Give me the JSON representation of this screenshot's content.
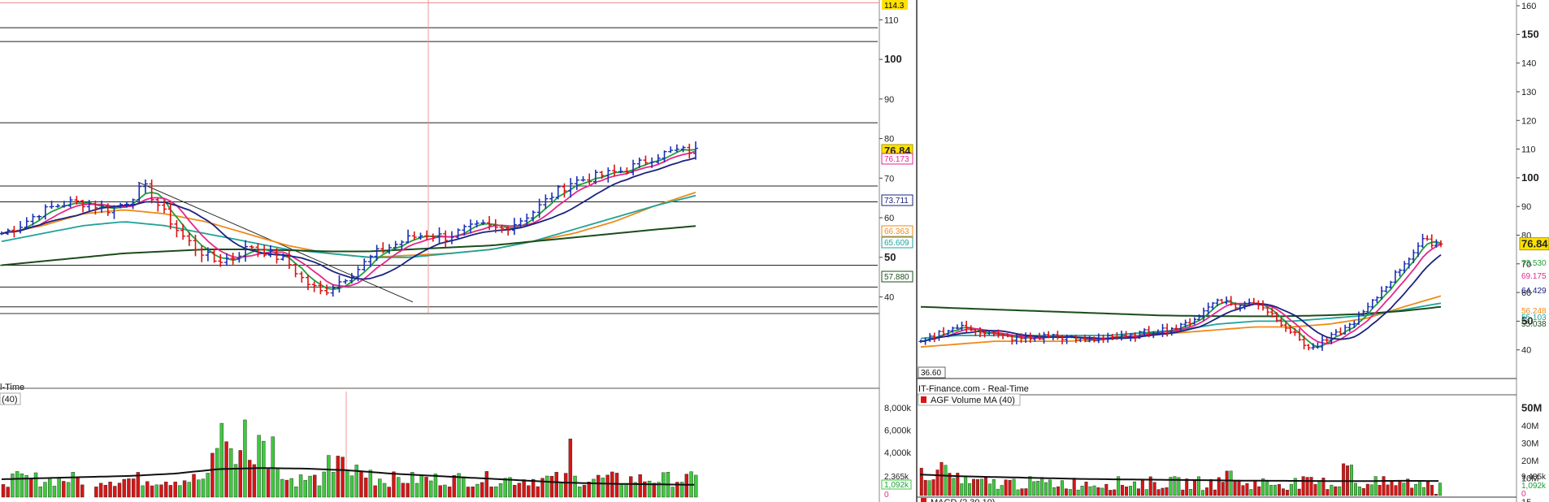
{
  "chart_data": [
    {
      "type": "candlestick",
      "panel": "left-price",
      "title_fragment": "l-Time",
      "yticks": [
        "110",
        "100",
        "90",
        "80",
        "70",
        "60",
        "50",
        "40"
      ],
      "ytick_values": [
        110,
        100,
        90,
        80,
        70,
        60,
        50,
        40
      ],
      "bold_ticks": [
        "100",
        "50"
      ],
      "ylim": [
        36,
        115
      ],
      "last_price": "76.84",
      "top_marker": "114.3",
      "indicator_tags": [
        {
          "label": "76.173",
          "value": 76.173,
          "color": "#e6268c"
        },
        {
          "label": "73.711",
          "value": 73.711,
          "color": "#1a237e"
        },
        {
          "label": "66.363",
          "value": 66.363,
          "color": "#ef8a17"
        },
        {
          "label": "65.609",
          "value": 65.609,
          "color": "#1fa39a"
        },
        {
          "label": "57.880",
          "value": 57.88,
          "color": "#1b4d1b"
        }
      ],
      "horizontal_levels": [
        108,
        104.5,
        84,
        68,
        64,
        48,
        42.5,
        37.5
      ],
      "series_colors": {
        "ma_fast": "#1f9e3a",
        "ma_mid": "#e6268c",
        "ma_slow": "#1a237e",
        "ma_long1": "#ef8a17",
        "ma_long2": "#1fa39a",
        "ma_long3": "#1b4d1b"
      }
    },
    {
      "type": "bar",
      "panel": "left-volume",
      "legend": "(40)",
      "yticks": [
        "8,000k",
        "6,000k",
        "4,000k"
      ],
      "ytick_values": [
        8000,
        6000,
        4000
      ],
      "ylim": [
        0,
        9000
      ],
      "tags": [
        "2,365k",
        "1,092k",
        "0"
      ]
    },
    {
      "type": "candlestick",
      "panel": "right-price",
      "source_label": "IT-Finance.com - Real-Time",
      "low_label": "36.60",
      "yticks": [
        "160",
        "150",
        "140",
        "130",
        "120",
        "110",
        "100",
        "90",
        "80",
        "70",
        "60",
        "50",
        "40"
      ],
      "ytick_values": [
        160,
        150,
        140,
        130,
        120,
        110,
        100,
        90,
        80,
        70,
        60,
        50,
        40
      ],
      "bold_ticks": [
        "150",
        "100",
        "50"
      ],
      "ylim": [
        30,
        162
      ],
      "last_price": "76.84",
      "indicator_tags": [
        {
          "label": "73.530",
          "value": 73.53,
          "color": "#1f9e3a"
        },
        {
          "label": "69.175",
          "value": 69.175,
          "color": "#e6268c"
        },
        {
          "label": "64.429",
          "value": 64.429,
          "color": "#1a237e"
        },
        {
          "label": "56.248",
          "value": 58.8,
          "color": "#ef8a17"
        },
        {
          "label": "55.103",
          "value": 56.3,
          "color": "#1fa39a"
        },
        {
          "label": "55.038",
          "value": 54.0,
          "color": "#1b4d1b"
        }
      ]
    },
    {
      "type": "bar",
      "panel": "right-volume",
      "legend": "AGF Volume  MA (40)",
      "yticks": [
        "50M",
        "40M",
        "30M",
        "20M",
        "10M"
      ],
      "ytick_values": [
        50,
        40,
        30,
        20,
        10
      ],
      "ylim": [
        0,
        52
      ],
      "tags": [
        "9,485k",
        "1,092k",
        "0"
      ],
      "bottom_fragment": "MACD (2,30,10)",
      "bottom_tick": "15"
    }
  ]
}
